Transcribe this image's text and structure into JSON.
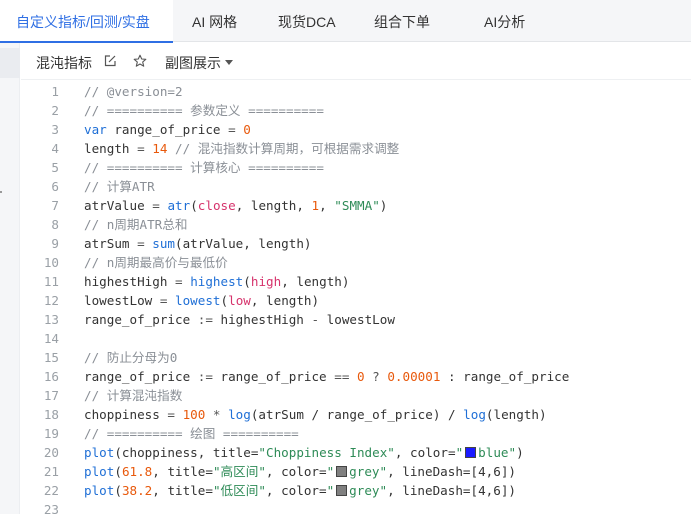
{
  "tabs": [
    {
      "label": "自定义指标/回测/实盘",
      "active": true
    },
    {
      "label": "AI 网格",
      "active": false
    },
    {
      "label": "现货DCA",
      "active": false
    },
    {
      "label": "组合下单",
      "active": false
    },
    {
      "label": "AI分析",
      "active": false
    }
  ],
  "toolbar": {
    "title": "混沌指标",
    "edit_icon": "edit-icon",
    "star_icon": "star-icon",
    "subchart_label": "副图展示",
    "subchart_icon": "caret-down-icon"
  },
  "colors": {
    "accent": "#2f6fe4",
    "comment": "#8a8f96",
    "keyword": "#1f6fd6",
    "number": "#e8590c",
    "string": "#2e8b57",
    "builtin": "#d6336c",
    "swatch_blue": "#1a1aff",
    "swatch_grey": "#808080"
  },
  "code_lines": [
    [
      {
        "t": "// @version=2",
        "c": "cm"
      }
    ],
    [
      {
        "t": "// ========== 参数定义 ==========",
        "c": "cm"
      }
    ],
    [
      {
        "t": "var",
        "c": "kw"
      },
      {
        "t": " range_of_price ",
        "c": ""
      },
      {
        "t": "=",
        "c": "op"
      },
      {
        "t": " ",
        "c": ""
      },
      {
        "t": "0",
        "c": "num"
      }
    ],
    [
      {
        "t": "length ",
        "c": ""
      },
      {
        "t": "=",
        "c": "op"
      },
      {
        "t": " ",
        "c": ""
      },
      {
        "t": "14",
        "c": "num"
      },
      {
        "t": " // 混沌指数计算周期，可根据需求调整",
        "c": "cm"
      }
    ],
    [
      {
        "t": "// ========== 计算核心 ==========",
        "c": "cm"
      }
    ],
    [
      {
        "t": "// 计算ATR",
        "c": "cm"
      }
    ],
    [
      {
        "t": "atrValue ",
        "c": ""
      },
      {
        "t": "=",
        "c": "op"
      },
      {
        "t": " ",
        "c": ""
      },
      {
        "t": "atr",
        "c": "fn"
      },
      {
        "t": "(",
        "c": ""
      },
      {
        "t": "close",
        "c": "bi"
      },
      {
        "t": ", length, ",
        "c": ""
      },
      {
        "t": "1",
        "c": "num"
      },
      {
        "t": ", ",
        "c": ""
      },
      {
        "t": "\"SMMA\"",
        "c": "str"
      },
      {
        "t": ")",
        "c": ""
      }
    ],
    [
      {
        "t": "// n周期ATR总和",
        "c": "cm"
      }
    ],
    [
      {
        "t": "atrSum ",
        "c": ""
      },
      {
        "t": "=",
        "c": "op"
      },
      {
        "t": " ",
        "c": ""
      },
      {
        "t": "sum",
        "c": "fn"
      },
      {
        "t": "(atrValue, length)",
        "c": ""
      }
    ],
    [
      {
        "t": "// n周期最高价与最低价",
        "c": "cm"
      }
    ],
    [
      {
        "t": "highestHigh ",
        "c": ""
      },
      {
        "t": "=",
        "c": "op"
      },
      {
        "t": " ",
        "c": ""
      },
      {
        "t": "highest",
        "c": "fn"
      },
      {
        "t": "(",
        "c": ""
      },
      {
        "t": "high",
        "c": "bi"
      },
      {
        "t": ", length)",
        "c": ""
      }
    ],
    [
      {
        "t": "lowestLow ",
        "c": ""
      },
      {
        "t": "=",
        "c": "op"
      },
      {
        "t": " ",
        "c": ""
      },
      {
        "t": "lowest",
        "c": "fn"
      },
      {
        "t": "(",
        "c": ""
      },
      {
        "t": "low",
        "c": "bi"
      },
      {
        "t": ", length)",
        "c": ""
      }
    ],
    [
      {
        "t": "range_of_price ",
        "c": ""
      },
      {
        "t": ":=",
        "c": "op"
      },
      {
        "t": " highestHigh ",
        "c": ""
      },
      {
        "t": "-",
        "c": "op"
      },
      {
        "t": " lowestLow",
        "c": ""
      }
    ],
    [],
    [
      {
        "t": "// 防止分母为0",
        "c": "cm"
      }
    ],
    [
      {
        "t": "range_of_price ",
        "c": ""
      },
      {
        "t": ":=",
        "c": "op"
      },
      {
        "t": " range_of_price ",
        "c": ""
      },
      {
        "t": "==",
        "c": "op"
      },
      {
        "t": " ",
        "c": ""
      },
      {
        "t": "0",
        "c": "num"
      },
      {
        "t": " ? ",
        "c": "op"
      },
      {
        "t": "0.00001",
        "c": "num"
      },
      {
        "t": " : range_of_price",
        "c": ""
      }
    ],
    [
      {
        "t": "// 计算混沌指数",
        "c": "cm"
      }
    ],
    [
      {
        "t": "choppiness ",
        "c": ""
      },
      {
        "t": "=",
        "c": "op"
      },
      {
        "t": " ",
        "c": ""
      },
      {
        "t": "100",
        "c": "num"
      },
      {
        "t": " * ",
        "c": "op"
      },
      {
        "t": "log",
        "c": "fn"
      },
      {
        "t": "(atrSum / range_of_price) / ",
        "c": ""
      },
      {
        "t": "log",
        "c": "fn"
      },
      {
        "t": "(length)",
        "c": ""
      }
    ],
    [
      {
        "t": "// ========== 绘图 ==========",
        "c": "cm"
      }
    ],
    [
      {
        "t": "plot",
        "c": "fn"
      },
      {
        "t": "(choppiness, title=",
        "c": ""
      },
      {
        "t": "\"Choppiness Index\"",
        "c": "str"
      },
      {
        "t": ", color=",
        "c": ""
      },
      {
        "t": "\"",
        "c": "str"
      },
      {
        "t": "",
        "c": "sw",
        "color": "#1a1aff"
      },
      {
        "t": "blue\"",
        "c": "str"
      },
      {
        "t": ")",
        "c": ""
      }
    ],
    [
      {
        "t": "plot",
        "c": "fn"
      },
      {
        "t": "(",
        "c": ""
      },
      {
        "t": "61.8",
        "c": "num"
      },
      {
        "t": ", title=",
        "c": ""
      },
      {
        "t": "\"高区间\"",
        "c": "str"
      },
      {
        "t": ", color=",
        "c": ""
      },
      {
        "t": "\"",
        "c": "str"
      },
      {
        "t": "",
        "c": "sw",
        "color": "#808080"
      },
      {
        "t": "grey\"",
        "c": "str"
      },
      {
        "t": ", lineDash=[4,6])",
        "c": ""
      }
    ],
    [
      {
        "t": "plot",
        "c": "fn"
      },
      {
        "t": "(",
        "c": ""
      },
      {
        "t": "38.2",
        "c": "num"
      },
      {
        "t": ", title=",
        "c": ""
      },
      {
        "t": "\"低区间\"",
        "c": "str"
      },
      {
        "t": ", color=",
        "c": ""
      },
      {
        "t": "\"",
        "c": "str"
      },
      {
        "t": "",
        "c": "sw",
        "color": "#808080"
      },
      {
        "t": "grey\"",
        "c": "str"
      },
      {
        "t": ", lineDash=[4,6])",
        "c": ""
      }
    ],
    []
  ]
}
